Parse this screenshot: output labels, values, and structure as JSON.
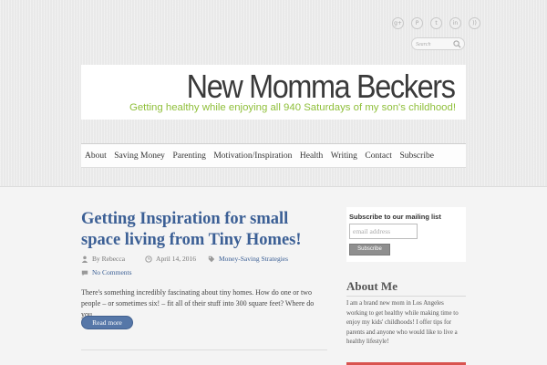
{
  "social_icons": [
    {
      "icon": "google-plus-icon",
      "glyph": "g+"
    },
    {
      "icon": "pinterest-icon",
      "glyph": "P"
    },
    {
      "icon": "twitter-icon",
      "glyph": "t"
    },
    {
      "icon": "linkedin-icon",
      "glyph": "in"
    },
    {
      "icon": "rss-icon",
      "glyph": "))"
    }
  ],
  "search": {
    "placeholder": "Search"
  },
  "header": {
    "title": "New Momma Beckers",
    "tagline": "Getting healthy while enjoying all 940 Saturdays of my son's childhood!"
  },
  "nav": {
    "items": [
      "About",
      "Saving Money",
      "Parenting",
      "Motivation/Inspiration",
      "Health",
      "Writing",
      "Contact",
      "Subscribe"
    ]
  },
  "post": {
    "title": "Getting Inspiration for small space living from Tiny Homes!",
    "author": "By Rebecca",
    "date": "April 14, 2016",
    "category": "Money-Saving Strategies",
    "comments": "No Comments",
    "excerpt": "There's something incredibly fascinating about tiny homes.  How do one or two people – or sometimes six! – fit all of their stuff into 300 square feet?  Where do you...",
    "read_more": "Read more"
  },
  "sidebar": {
    "subscribe": {
      "title": "Subscribe to our mailing list",
      "placeholder": "email address",
      "button": "Subscribe"
    },
    "about": {
      "heading": "About Me",
      "text": "I am a brand new mom in Los Angeles working to get healthy while making time to enjoy my kids' childhoods! I offer tips for parents and anyone who would like to live a healthy lifestyle!"
    }
  },
  "colors": {
    "link": "#3b5f95",
    "tagline": "#8fbf3a",
    "button": "#5677a8",
    "accent_red": "#d9534f"
  }
}
